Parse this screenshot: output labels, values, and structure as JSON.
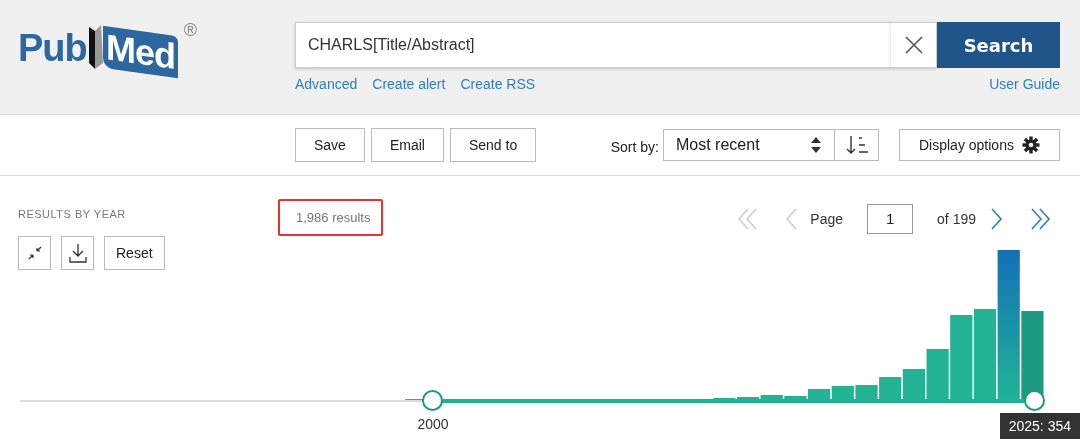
{
  "logo": {
    "first": "Pub",
    "second": "Med",
    "mark": "®"
  },
  "search": {
    "value": "CHARLS[Title/Abstract]",
    "button": "Search"
  },
  "search_links": [
    "Advanced",
    "Create alert",
    "Create RSS"
  ],
  "user_guide": "User Guide",
  "actions": [
    "Save",
    "Email",
    "Send to"
  ],
  "sort": {
    "label": "Sort by:",
    "value": "Most recent"
  },
  "display_options": "Display options",
  "results_by_year": {
    "title": "RESULTS BY YEAR",
    "reset": "Reset"
  },
  "results_count": "1,986 results",
  "pagination": {
    "label": "Page",
    "page": "1",
    "of": "of 199"
  },
  "year_slider": {
    "handles": [
      {
        "label": "2000",
        "level": 0.405
      },
      {
        "tooltip": "2025: 354",
        "level": 0.995
      }
    ]
  }
}
